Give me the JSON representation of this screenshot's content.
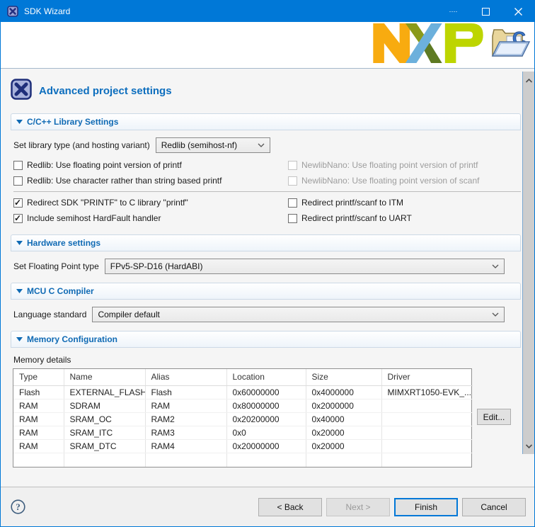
{
  "colors": {
    "titlebar": "#0078d7",
    "accent": "#0078d7",
    "section_title": "#0f6ab4",
    "heading_title": "#0d6ebe",
    "nxp_orange": "#f8ab10",
    "nxp_blue": "#6cb0dc",
    "nxp_green": "#bdd500",
    "nxp_olive": "#8a9a1a"
  },
  "window": {
    "title": "SDK Wizard"
  },
  "icons": {
    "help_glyph": "?"
  },
  "page": {
    "title": "Advanced project settings"
  },
  "library": {
    "title": "C/C++ Library Settings",
    "type_label": "Set library type (and hosting variant)",
    "type_value": "Redlib (semihost-nf)",
    "cb_redlib_fp": {
      "label": "Redlib: Use floating point version of printf",
      "checked": false,
      "disabled": false
    },
    "cb_redlib_char": {
      "label": "Redlib: Use character rather than string based printf",
      "checked": false,
      "disabled": false
    },
    "cb_newlib_printf": {
      "label": "NewlibNano: Use floating point version of printf",
      "checked": false,
      "disabled": true
    },
    "cb_newlib_scanf": {
      "label": "NewlibNano: Use floating point version of scanf",
      "checked": false,
      "disabled": true
    },
    "cb_redirect_printf": {
      "label": "Redirect SDK \"PRINTF\" to C library \"printf\"",
      "checked": true,
      "disabled": false
    },
    "cb_semihost": {
      "label": "Include semihost HardFault handler",
      "checked": true,
      "disabled": false
    },
    "cb_itm": {
      "label": "Redirect printf/scanf to ITM",
      "checked": false,
      "disabled": false
    },
    "cb_uart": {
      "label": "Redirect printf/scanf to UART",
      "checked": false,
      "disabled": false
    }
  },
  "hardware": {
    "title": "Hardware settings",
    "fp_label": "Set Floating Point type",
    "fp_value": "FPv5-SP-D16 (HardABI)"
  },
  "compiler": {
    "title": "MCU C Compiler",
    "lang_label": "Language standard",
    "lang_value": "Compiler default"
  },
  "memory": {
    "title": "Memory Configuration",
    "details_label": "Memory details",
    "edit_button": "Edit...",
    "table": {
      "headers": [
        "Type",
        "Name",
        "Alias",
        "Location",
        "Size",
        "Driver"
      ],
      "rows": [
        [
          "Flash",
          "EXTERNAL_FLASH",
          "Flash",
          "0x60000000",
          "0x4000000",
          "MIMXRT1050-EVK_..."
        ],
        [
          "RAM",
          "SDRAM",
          "RAM",
          "0x80000000",
          "0x2000000",
          ""
        ],
        [
          "RAM",
          "SRAM_OC",
          "RAM2",
          "0x20200000",
          "0x40000",
          ""
        ],
        [
          "RAM",
          "SRAM_ITC",
          "RAM3",
          "0x0",
          "0x20000",
          ""
        ],
        [
          "RAM",
          "SRAM_DTC",
          "RAM4",
          "0x20000000",
          "0x20000",
          ""
        ]
      ]
    }
  },
  "buttons": {
    "back": "< Back",
    "next": "Next >",
    "finish": "Finish",
    "cancel": "Cancel"
  }
}
